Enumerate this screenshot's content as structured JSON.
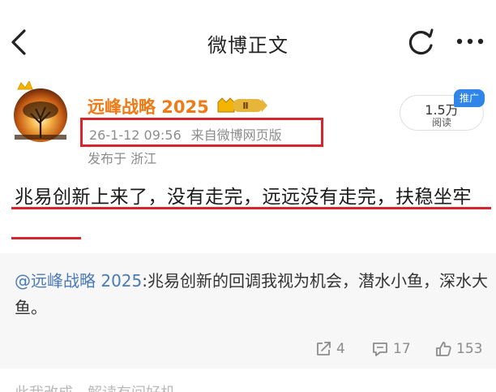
{
  "nav": {
    "title": "微博正文",
    "back_icon": "chevron-left-icon",
    "refresh_icon": "refresh-icon",
    "more_icon": "more-dots-icon"
  },
  "post": {
    "author": "远峰战略 2025",
    "timestamp": "26-1-12 09:56",
    "source": "来自微博网页版",
    "location": "发布于 浙江",
    "text": "兆易创新上来了，没有走完，远远没有走完，扶稳坐牢",
    "vip_level": "Ⅱ",
    "follower_count": "1.5万",
    "follower_label": "阅读",
    "promo_tag": "推广"
  },
  "repost": {
    "user": "@远峰战略 2025",
    "text": ":兆易创新的回调我视为机会，潜水小鱼，深水大鱼。",
    "repost_count": "4",
    "comment_count": "17",
    "like_count": "153"
  },
  "footer": {
    "cut_text": "此我改成，解读有间好机"
  },
  "colors": {
    "accent_orange": "#ef7a16",
    "highlight_red": "#d8242c",
    "link_blue": "#4a7ab8",
    "promo_blue": "#2f86e8",
    "muted_gray": "#8c8c8c"
  }
}
